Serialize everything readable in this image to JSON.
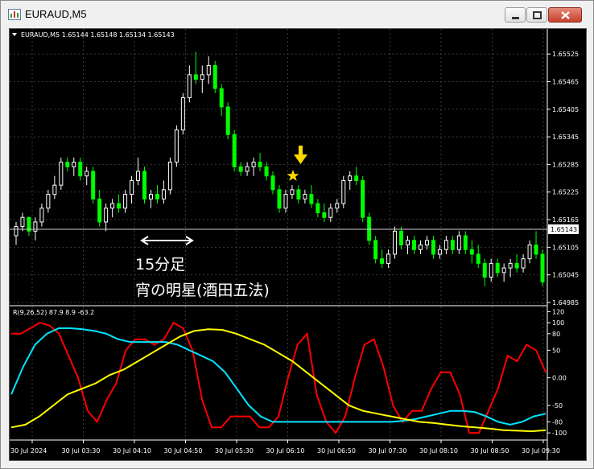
{
  "window": {
    "title": "EURAUD,M5",
    "icon": "chart-app-icon"
  },
  "chart": {
    "header": "EURAUD,M5  1.65144 1.65148 1.65134 1.65143",
    "price_scale": [
      "1.65525",
      "1.65465",
      "1.65405",
      "1.65345",
      "1.65285",
      "1.65225",
      "1.65165",
      "1.65105",
      "1.65045",
      "1.64985"
    ],
    "current_price": "1.65143",
    "annotation_line1": "15分足",
    "annotation_line2": "宵の明星(酒田五法)",
    "colors": {
      "bull": "#ffffff",
      "bear": "#00ff00",
      "background": "#000000",
      "grid": "#3a3a3a"
    }
  },
  "indicator": {
    "label": "R(9,26,52) 87.9 8.9 -63.2",
    "scale": [
      "120",
      "100",
      "80",
      "50",
      "0.00",
      "-50",
      "-80",
      "-100"
    ]
  },
  "time_axis": [
    "30 Jul 2024",
    "30 Jul 03:30",
    "30 Jul 04:10",
    "30 Jul 04:50",
    "30 Jul 05:30",
    "30 Jul 06:10",
    "30 Jul 06:50",
    "30 Jul 07:30",
    "30 Jul 08:10",
    "30 Jul 08:50",
    "30 Jul 09:30"
  ],
  "chart_data": {
    "type": "candlestick",
    "price_range": [
      1.64985,
      1.65555
    ],
    "candles": [
      [
        1.6513,
        1.6516,
        1.6511,
        1.6515
      ],
      [
        1.6515,
        1.6518,
        1.6514,
        1.6517
      ],
      [
        1.6517,
        1.6516,
        1.6513,
        1.6514
      ],
      [
        1.6514,
        1.6517,
        1.6512,
        1.6516
      ],
      [
        1.6516,
        1.652,
        1.6515,
        1.6519
      ],
      [
        1.6519,
        1.6523,
        1.6518,
        1.6522
      ],
      [
        1.6522,
        1.6526,
        1.6521,
        1.6524
      ],
      [
        1.6524,
        1.653,
        1.6523,
        1.6529
      ],
      [
        1.6529,
        1.653,
        1.6527,
        1.6528
      ],
      [
        1.6528,
        1.653,
        1.6526,
        1.6529
      ],
      [
        1.6529,
        1.653,
        1.6525,
        1.6526
      ],
      [
        1.6526,
        1.6528,
        1.6524,
        1.6527
      ],
      [
        1.6527,
        1.6528,
        1.652,
        1.6521
      ],
      [
        1.6521,
        1.6523,
        1.6515,
        1.6516
      ],
      [
        1.6516,
        1.652,
        1.6514,
        1.6519
      ],
      [
        1.6519,
        1.6521,
        1.6517,
        1.652
      ],
      [
        1.652,
        1.6522,
        1.6518,
        1.6519
      ],
      [
        1.6519,
        1.6523,
        1.6518,
        1.6522
      ],
      [
        1.6522,
        1.6526,
        1.652,
        1.6525
      ],
      [
        1.6525,
        1.653,
        1.6524,
        1.6527
      ],
      [
        1.6527,
        1.6528,
        1.652,
        1.6521
      ],
      [
        1.6521,
        1.6523,
        1.6519,
        1.6522
      ],
      [
        1.6522,
        1.6524,
        1.652,
        1.6521
      ],
      [
        1.6521,
        1.6525,
        1.652,
        1.6523
      ],
      [
        1.6523,
        1.653,
        1.6522,
        1.6529
      ],
      [
        1.6529,
        1.6537,
        1.6528,
        1.6536
      ],
      [
        1.6536,
        1.6544,
        1.6535,
        1.6543
      ],
      [
        1.6543,
        1.655,
        1.6542,
        1.6548
      ],
      [
        1.6548,
        1.6553,
        1.6546,
        1.6547
      ],
      [
        1.6547,
        1.655,
        1.6544,
        1.6548
      ],
      [
        1.6548,
        1.6552,
        1.6546,
        1.655
      ],
      [
        1.655,
        1.6551,
        1.6544,
        1.6545
      ],
      [
        1.6545,
        1.6546,
        1.6539,
        1.6541
      ],
      [
        1.6541,
        1.6542,
        1.6534,
        1.6535
      ],
      [
        1.6535,
        1.6536,
        1.6527,
        1.6528
      ],
      [
        1.6528,
        1.6529,
        1.6526,
        1.6527
      ],
      [
        1.6527,
        1.6529,
        1.6526,
        1.6528
      ],
      [
        1.6528,
        1.653,
        1.6526,
        1.6529
      ],
      [
        1.6529,
        1.6531,
        1.6527,
        1.6528
      ],
      [
        1.6528,
        1.6529,
        1.6525,
        1.6526
      ],
      [
        1.6526,
        1.6527,
        1.6522,
        1.6523
      ],
      [
        1.6523,
        1.6524,
        1.6518,
        1.6519
      ],
      [
        1.6519,
        1.6523,
        1.6518,
        1.6522
      ],
      [
        1.6522,
        1.6524,
        1.6521,
        1.6523
      ],
      [
        1.6523,
        1.6524,
        1.652,
        1.6521
      ],
      [
        1.6521,
        1.6523,
        1.652,
        1.6522
      ],
      [
        1.6522,
        1.6524,
        1.6519,
        1.652
      ],
      [
        1.652,
        1.6521,
        1.6517,
        1.6518
      ],
      [
        1.6518,
        1.652,
        1.6516,
        1.6517
      ],
      [
        1.6517,
        1.652,
        1.6516,
        1.6519
      ],
      [
        1.6519,
        1.6521,
        1.6518,
        1.652
      ],
      [
        1.652,
        1.6526,
        1.6519,
        1.6525
      ],
      [
        1.6525,
        1.6527,
        1.6523,
        1.6526
      ],
      [
        1.6526,
        1.6528,
        1.6524,
        1.6525
      ],
      [
        1.6525,
        1.6526,
        1.6516,
        1.6517
      ],
      [
        1.6517,
        1.6518,
        1.6511,
        1.6512
      ],
      [
        1.6512,
        1.6513,
        1.6507,
        1.6508
      ],
      [
        1.6508,
        1.651,
        1.6506,
        1.6507
      ],
      [
        1.6507,
        1.651,
        1.6506,
        1.6509
      ],
      [
        1.6509,
        1.6515,
        1.6508,
        1.6514
      ],
      [
        1.6514,
        1.6515,
        1.651,
        1.6511
      ],
      [
        1.6511,
        1.6513,
        1.6509,
        1.6512
      ],
      [
        1.6512,
        1.6513,
        1.6509,
        1.651
      ],
      [
        1.651,
        1.6512,
        1.6509,
        1.6511
      ],
      [
        1.6511,
        1.6513,
        1.651,
        1.6512
      ],
      [
        1.6512,
        1.6513,
        1.6508,
        1.6509
      ],
      [
        1.6509,
        1.6511,
        1.6508,
        1.651
      ],
      [
        1.651,
        1.6513,
        1.6509,
        1.6512
      ],
      [
        1.6512,
        1.6513,
        1.6509,
        1.651
      ],
      [
        1.651,
        1.6514,
        1.6509,
        1.6513
      ],
      [
        1.6513,
        1.6514,
        1.6509,
        1.651
      ],
      [
        1.651,
        1.6512,
        1.6507,
        1.6509
      ],
      [
        1.6509,
        1.6511,
        1.6506,
        1.6507
      ],
      [
        1.6507,
        1.6508,
        1.6502,
        1.6504
      ],
      [
        1.6504,
        1.6508,
        1.6503,
        1.6507
      ],
      [
        1.6507,
        1.6508,
        1.6504,
        1.6505
      ],
      [
        1.6505,
        1.6507,
        1.6503,
        1.6506
      ],
      [
        1.6506,
        1.6508,
        1.6504,
        1.6507
      ],
      [
        1.6507,
        1.6509,
        1.6505,
        1.6506
      ],
      [
        1.6506,
        1.6509,
        1.6505,
        1.6508
      ],
      [
        1.6508,
        1.6512,
        1.6507,
        1.6511
      ],
      [
        1.6511,
        1.6514,
        1.6508,
        1.6509
      ],
      [
        1.6509,
        1.651,
        1.6502,
        1.6503
      ]
    ],
    "indicator_range": [
      -110,
      125
    ],
    "series": [
      {
        "color": "#ff0000",
        "values": [
          80,
          80,
          90,
          100,
          95,
          80,
          40,
          0,
          -60,
          -80,
          -40,
          -10,
          50,
          70,
          70,
          60,
          70,
          100,
          90,
          50,
          -40,
          -90,
          -90,
          -70,
          -70,
          -70,
          -90,
          -90,
          -70,
          0,
          60,
          80,
          -30,
          -80,
          -100,
          -70,
          0,
          60,
          70,
          20,
          -50,
          -80,
          -60,
          -60,
          -20,
          10,
          10,
          -30,
          -100,
          -100,
          -60,
          -20,
          40,
          30,
          60,
          50,
          10
        ]
      },
      {
        "color": "#00e5ff",
        "values": [
          -30,
          20,
          60,
          80,
          90,
          90,
          88,
          85,
          80,
          70,
          65,
          65,
          65,
          65,
          60,
          50,
          40,
          30,
          10,
          -20,
          -50,
          -70,
          -80,
          -80,
          -80,
          -80,
          -80,
          -80,
          -80,
          -80,
          -80,
          -80,
          -80,
          -78,
          -75,
          -70,
          -65,
          -60,
          -60,
          -62,
          -70,
          -80,
          -85,
          -80,
          -70,
          -65
        ]
      },
      {
        "color": "#ffff00",
        "values": [
          -90,
          -85,
          -70,
          -50,
          -30,
          -20,
          -10,
          5,
          15,
          30,
          45,
          60,
          75,
          85,
          88,
          87,
          80,
          70,
          60,
          45,
          30,
          10,
          -10,
          -30,
          -50,
          -60,
          -65,
          -70,
          -75,
          -80,
          -82,
          -85,
          -88,
          -90,
          -92,
          -95,
          -96,
          -97,
          -95
        ]
      }
    ]
  }
}
